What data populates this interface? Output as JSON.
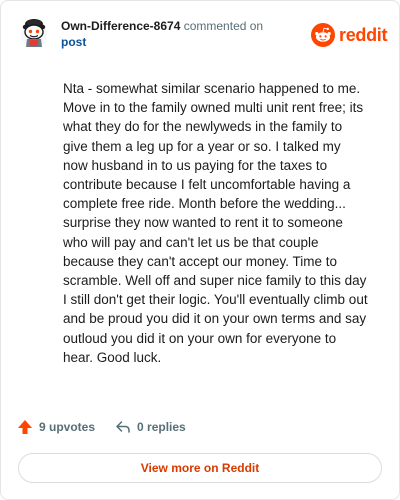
{
  "header": {
    "author": "Own-Difference-8674",
    "action": "commented on",
    "post_link": "post"
  },
  "brand": {
    "name": "reddit",
    "icon": "reddit-logo-icon",
    "color": "#ff4500"
  },
  "avatar": {
    "icon": "snoo-avatar-icon"
  },
  "comment": {
    "text": "Nta - somewhat similar scenario happened to me. Move in to the family owned multi unit rent free; its what they do for the newlyweds in the family to give them a leg up for a year or so. I talked my now husband in to us paying for the taxes to contribute because I felt uncomfortable having a complete free ride. Month before the wedding... surprise they now wanted to rent it to someone who will pay and can't let us be that couple because they can't accept our money. Time to scramble. Well off and super nice family to this day I still don't get their logic. You'll eventually climb out and be proud you did it on your own terms and say outloud you did it on your own for everyone to hear. Good luck."
  },
  "footer": {
    "upvotes": "9 upvotes",
    "upvote_icon": "upvote-arrow-icon",
    "replies": "0 replies",
    "reply_icon": "reply-arrow-icon"
  },
  "actions": {
    "view_more": "View more on Reddit"
  }
}
